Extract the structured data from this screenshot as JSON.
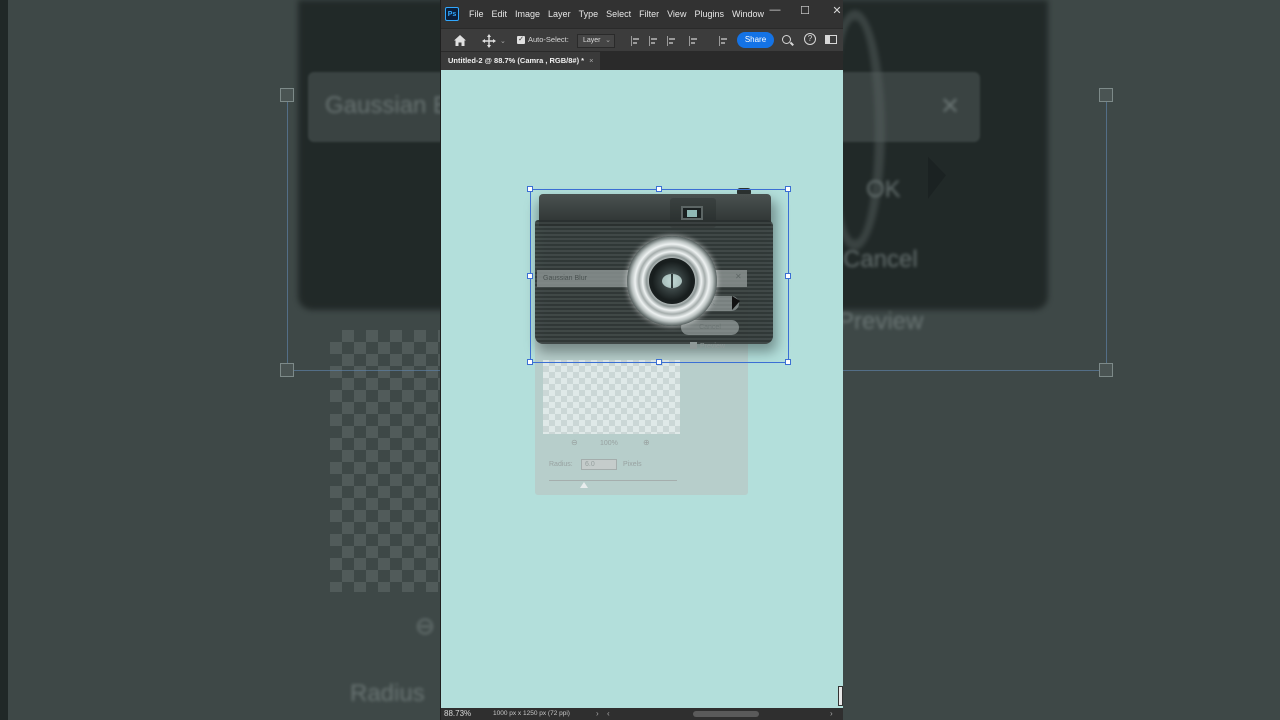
{
  "app": {
    "logo": "Ps"
  },
  "menu": {
    "items": [
      "File",
      "Edit",
      "Image",
      "Layer",
      "Type",
      "Select",
      "Filter",
      "View",
      "Plugins",
      "Window"
    ]
  },
  "window_controls": {
    "minimize": "—",
    "maximize": "☐",
    "close": "✕"
  },
  "options": {
    "auto_select_label": "Auto-Select:",
    "auto_select_checked": "✓",
    "target_value": "Layer",
    "share_label": "Share",
    "help_glyph": "?"
  },
  "document_tab": {
    "title": "Untitled-2 @ 88.7% (Camra , RGB/8#) *",
    "close": "×"
  },
  "gaussian_dialog": {
    "title": "Gaussian Blur",
    "close": "✕",
    "ok_label": "OK",
    "cancel_label": "Cancel",
    "preview_label": "Preview",
    "zoom_value": "100%",
    "zoom_out": "⊖",
    "zoom_in": "⊕",
    "radius_label": "Radius:",
    "radius_value": "6.0",
    "radius_unit": "Pixels"
  },
  "background_ghost": {
    "dialog_title": "Gaussian B",
    "ok": "OK",
    "cancel": "Cancel",
    "preview": "Preview",
    "radius": "Radius",
    "zoom": "⊖"
  },
  "status": {
    "zoom": "88.73%",
    "doc_info": "1000 px x 1250 px (72 ppi)",
    "arrow_right": "›",
    "arrow_left": "‹"
  },
  "colors": {
    "canvas": "#b3dfdb",
    "accent": "#1473e6",
    "selection": "#3b6fd4"
  }
}
